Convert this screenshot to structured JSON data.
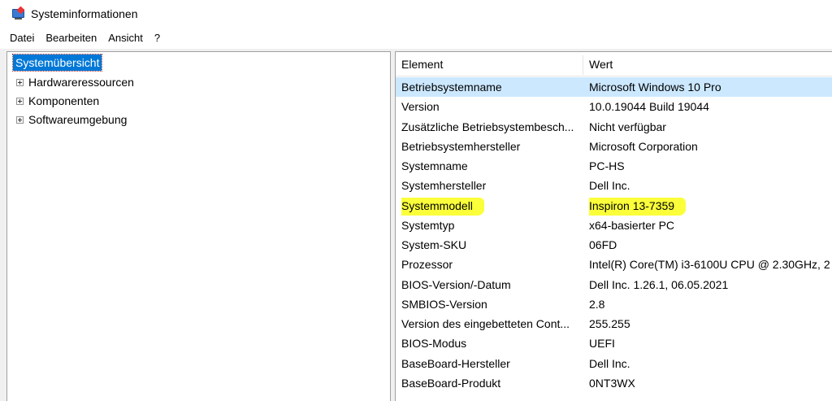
{
  "window": {
    "title": "Systeminformationen"
  },
  "menu": [
    "Datei",
    "Bearbeiten",
    "Ansicht",
    "?"
  ],
  "tree": {
    "root": "Systemübersicht",
    "children": [
      "Hardwareressourcen",
      "Komponenten",
      "Softwareumgebung"
    ]
  },
  "list": {
    "headers": {
      "element": "Element",
      "wert": "Wert"
    },
    "rows": [
      {
        "key": "Betriebsystemname",
        "value": "Microsoft Windows 10 Pro"
      },
      {
        "key": "Version",
        "value": "10.0.19044 Build 19044"
      },
      {
        "key": "Zusätzliche Betriebsystembesch...",
        "value": "Nicht verfügbar"
      },
      {
        "key": "Betriebsystemhersteller",
        "value": "Microsoft Corporation"
      },
      {
        "key": "Systemname",
        "value": "PC-HS"
      },
      {
        "key": "Systemhersteller",
        "value": "Dell Inc."
      },
      {
        "key": "Systemmodell",
        "value": "Inspiron 13-7359"
      },
      {
        "key": "Systemtyp",
        "value": "x64-basierter PC"
      },
      {
        "key": "System-SKU",
        "value": "06FD"
      },
      {
        "key": "Prozessor",
        "value": "Intel(R) Core(TM) i3-6100U CPU @ 2.30GHz, 2"
      },
      {
        "key": "BIOS-Version/-Datum",
        "value": "Dell Inc. 1.26.1, 06.05.2021"
      },
      {
        "key": "SMBIOS-Version",
        "value": "2.8"
      },
      {
        "key": "Version des eingebetteten Cont...",
        "value": "255.255"
      },
      {
        "key": "BIOS-Modus",
        "value": "UEFI"
      },
      {
        "key": "BaseBoard-Hersteller",
        "value": "Dell Inc."
      },
      {
        "key": "BaseBoard-Produkt",
        "value": "0NT3WX"
      }
    ]
  },
  "colors": {
    "selection": "#0078d7",
    "row_selected": "#cce8ff",
    "highlighter": "#fbff3a"
  }
}
